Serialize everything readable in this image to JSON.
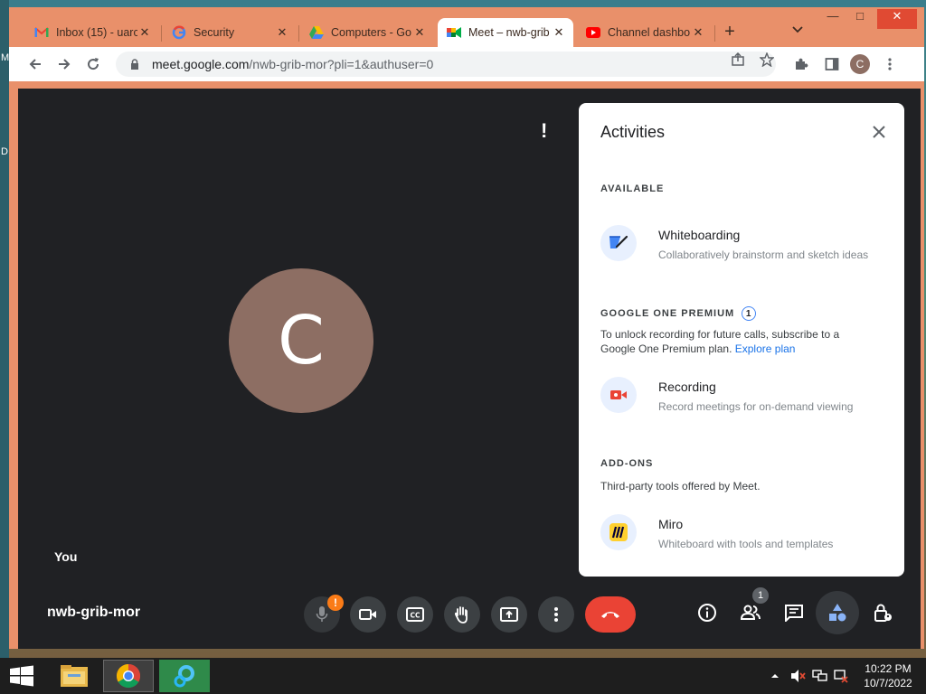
{
  "desktop": {
    "edge_letters": [
      "M",
      "D"
    ]
  },
  "tabs": [
    {
      "title": "Inbox (15) - uarc",
      "icon": "gmail-icon"
    },
    {
      "title": "Security",
      "icon": "google-icon"
    },
    {
      "title": "Computers - Go",
      "icon": "drive-icon"
    },
    {
      "title": "Meet – nwb-grib",
      "icon": "meet-icon",
      "active": true
    },
    {
      "title": "Channel dashbo",
      "icon": "youtube-icon"
    }
  ],
  "browser": {
    "new_tab": "+",
    "url_host": "meet.google.com",
    "url_path": "/nwb-grib-mor?pli=1&authuser=0",
    "profile_initial": "C",
    "window_controls": {
      "minimize": "—",
      "maximize": "□",
      "close": "✕"
    }
  },
  "meet": {
    "alert_mark": "!",
    "avatar_initial": "C",
    "self_label": "You",
    "meeting_code": "nwb-grib-mor",
    "mic_badge": "!",
    "people_count": "1"
  },
  "activities": {
    "title": "Activities",
    "available_header": "AVAILABLE",
    "whiteboarding": {
      "name": "Whiteboarding",
      "desc": "Collaboratively brainstorm and sketch ideas"
    },
    "premium_header": "GOOGLE ONE PREMIUM",
    "premium_badge": "1",
    "premium_text": "To unlock recording for future calls, subscribe to a Google One Premium plan.",
    "premium_link": "Explore plan",
    "recording": {
      "name": "Recording",
      "desc": "Record meetings for on-demand viewing"
    },
    "addons_header": "ADD-ONS",
    "addons_text": "Third-party tools offered by Meet.",
    "miro": {
      "name": "Miro",
      "desc": "Whiteboard with tools and templates"
    }
  },
  "taskbar": {
    "time": "10:22 PM",
    "date": "10/7/2022"
  },
  "colors": {
    "accent": "#1a73e8",
    "end_call": "#ea4335",
    "warning": "#fa7b17",
    "tab_strip": "#e9906a"
  }
}
